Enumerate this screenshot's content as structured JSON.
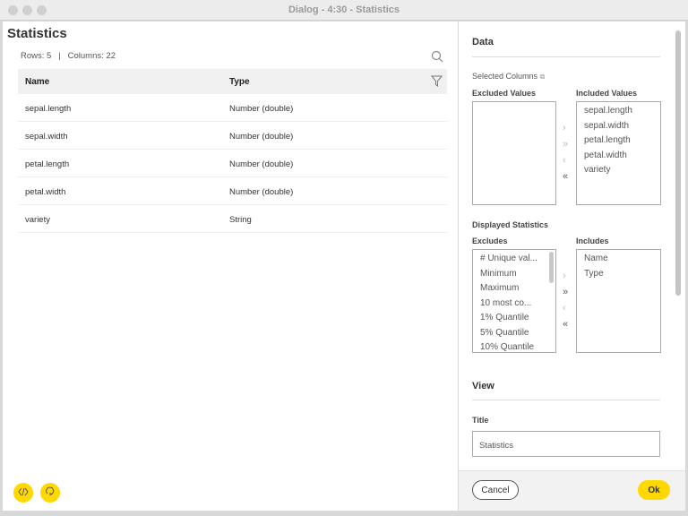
{
  "window": {
    "title": "Dialog - 4:30 - Statistics"
  },
  "table": {
    "title": "Statistics",
    "rows_label": "Rows: 5",
    "sep": "|",
    "cols_label": "Columns: 22",
    "headers": [
      "Name",
      "Type"
    ],
    "rows": [
      [
        "sepal.length",
        "Number (double)"
      ],
      [
        "sepal.width",
        "Number (double)"
      ],
      [
        "petal.length",
        "Number (double)"
      ],
      [
        "petal.width",
        "Number (double)"
      ],
      [
        "variety",
        "String"
      ]
    ]
  },
  "panel": {
    "data_heading": "Data",
    "selected_columns": "Selected Columns",
    "excluded_values": "Excluded Values",
    "included_values": "Included Values",
    "included": [
      "sepal.length",
      "sepal.width",
      "petal.length",
      "petal.width",
      "variety"
    ],
    "displayed_statistics": "Displayed Statistics",
    "excludes": "Excludes",
    "includes": "Includes",
    "excludes_items": [
      "# Unique val...",
      "Minimum",
      "Maximum",
      "10 most co...",
      "1% Quantile",
      "5% Quantile",
      "10% Quantile"
    ],
    "includes_items": [
      "Name",
      "Type"
    ],
    "view_heading": "View",
    "title_label": "Title",
    "title_value": "Statistics",
    "cancel": "Cancel",
    "ok": "Ok"
  },
  "colors": {
    "accent": "#ffd800"
  }
}
